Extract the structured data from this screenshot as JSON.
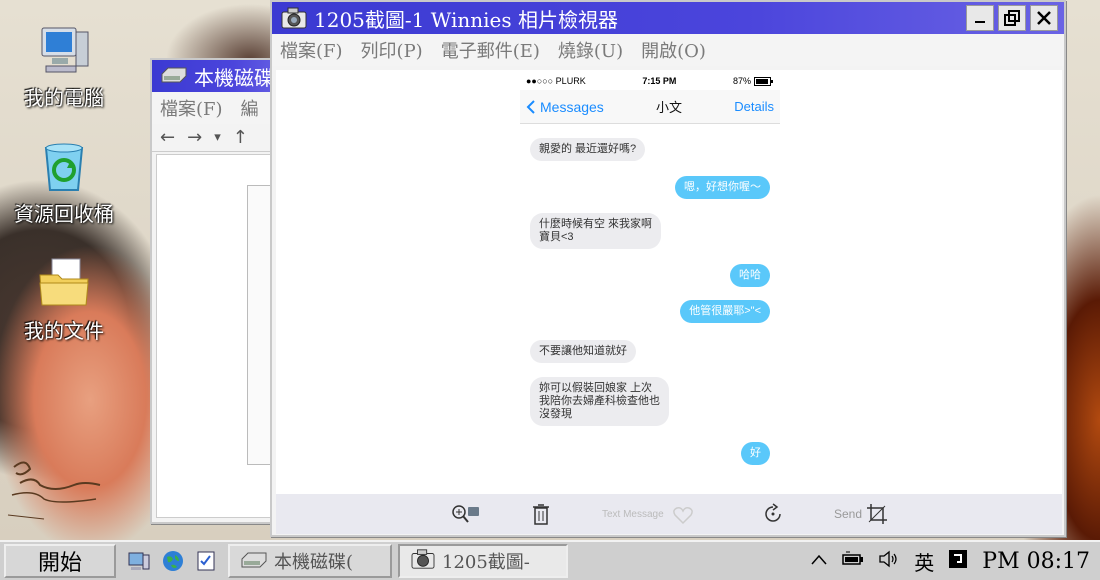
{
  "desktop": {
    "icons": [
      {
        "label": "我的電腦",
        "icon": "my-computer-icon"
      },
      {
        "label": "資源回收桶",
        "icon": "recycle-bin-icon"
      },
      {
        "label": "我的文件",
        "icon": "my-documents-icon"
      }
    ]
  },
  "drive_window": {
    "title": "本機磁碟",
    "menu": [
      "檔案(F)",
      "編"
    ],
    "toolbar": [
      "←",
      "→",
      "▾",
      "↑"
    ]
  },
  "viewer_window": {
    "title": "1205截圖-1 Winnies 相片檢視器",
    "menu": [
      "檔案(F)",
      "列印(P)",
      "電子郵件(E)",
      "燒錄(U)",
      "開啟(O)"
    ],
    "footer_icons": [
      "zoom-icon",
      "delete-icon",
      "rotate-icon",
      "crop-icon"
    ]
  },
  "phone": {
    "carrier": "●●○○○ PLURK",
    "time": "7:15 PM",
    "battery": "87%",
    "back_label": "Messages",
    "contact": "小文",
    "details_label": "Details",
    "input_placeholder": "Text Message",
    "send_label": "Send",
    "messages": [
      {
        "dir": "in",
        "text": "親愛的 最近還好嗎?"
      },
      {
        "dir": "out",
        "text": "嗯，好想你喔～"
      },
      {
        "dir": "in",
        "text": "什麼時候有空 來我家啊\n寶貝<3"
      },
      {
        "dir": "out",
        "text": "哈哈"
      },
      {
        "dir": "out",
        "text": "他管很嚴耶>\"<"
      },
      {
        "dir": "in",
        "text": "不要讓他知道就好"
      },
      {
        "dir": "in",
        "text": "妳可以假裝回娘家 上次\n我陪你去婦產科檢查他也\n沒發現"
      },
      {
        "dir": "out",
        "text": "好"
      }
    ]
  },
  "taskbar": {
    "start_label": "開始",
    "tasks": [
      {
        "label": "本機磁碟(",
        "icon": "drive-icon"
      },
      {
        "label": "1205截圖-",
        "icon": "camera-icon"
      }
    ],
    "ime": "英",
    "clock": "PM 08:17"
  }
}
